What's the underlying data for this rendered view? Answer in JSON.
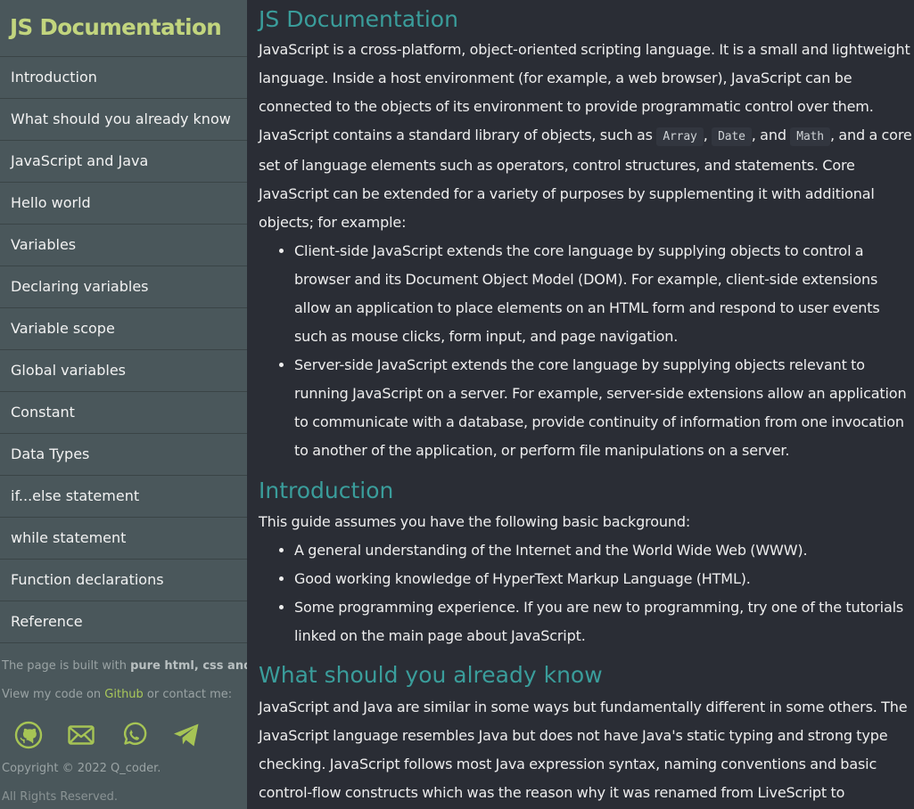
{
  "sidebar": {
    "title": "JS Documentation",
    "nav": [
      "Introduction",
      "What should you already know",
      "JavaScript and Java",
      "Hello world",
      "Variables",
      "Declaring variables",
      "Variable scope",
      "Global variables",
      "Constant",
      "Data Types",
      "if...else statement",
      "while statement",
      "Function declarations",
      "Reference"
    ],
    "footer": {
      "built_prefix": "The page is built with ",
      "built_bold": "pure html, css and js",
      "built_suffix": ".",
      "contact_prefix": "View my code on ",
      "github_link": "Github",
      "contact_suffix": " or contact me:",
      "icons": [
        "github-icon",
        "mail-icon",
        "whatsapp-icon",
        "telegram-icon"
      ],
      "copyright": "Copyright © 2022 Q_coder.",
      "rights": "All Rights Reserved."
    }
  },
  "main": {
    "doc_section": {
      "title": "JS Documentation",
      "p1": "JavaScript is a cross-platform, object-oriented scripting language. It is a small and lightweight language. Inside a host environment (for example, a web browser), JavaScript can be connected to the objects of its environment to provide programmatic control over them.",
      "p2_before": "JavaScript contains a standard library of objects, such as ",
      "code1": "Array",
      "sep1": ", ",
      "code2": "Date",
      "sep2": ", and ",
      "code3": "Math",
      "p2_after": ", and a core set of language elements such as operators, control structures, and statements. Core JavaScript can be extended for a variety of purposes by supplementing it with additional objects; for example:",
      "list": [
        "Client-side JavaScript extends the core language by supplying objects to control a browser and its Document Object Model (DOM). For example, client-side extensions allow an application to place elements on an HTML form and respond to user events such as mouse clicks, form input, and page navigation.",
        "Server-side JavaScript extends the core language by supplying objects relevant to running JavaScript on a server. For example, server-side extensions allow an application to communicate with a database, provide continuity of information from one invocation to another of the application, or perform file manipulations on a server."
      ]
    },
    "intro_section": {
      "title": "Introduction",
      "p": "This guide assumes you have the following basic background:",
      "list": [
        "A general understanding of the Internet and the World Wide Web (WWW).",
        "Good working knowledge of HyperText Markup Language (HTML).",
        "Some programming experience. If you are new to programming, try one of the tutorials linked on the main page about JavaScript."
      ]
    },
    "know_section": {
      "title": "What should you already know",
      "p": "JavaScript and Java are similar in some ways but fundamentally different in some others. The JavaScript language resembles Java but does not have Java's static typing and strong type checking. JavaScript follows most Java expression syntax, naming conventions and basic control-flow constructs which was the reason why it was renamed from LiveScript to JavaScript."
    }
  },
  "colors": {
    "sidebar_bg": "#4a575b",
    "main_bg": "#2a2d35",
    "title_accent": "#c2d57e",
    "heading_teal": "#3a9d9b",
    "link_green": "#a9c85a"
  }
}
